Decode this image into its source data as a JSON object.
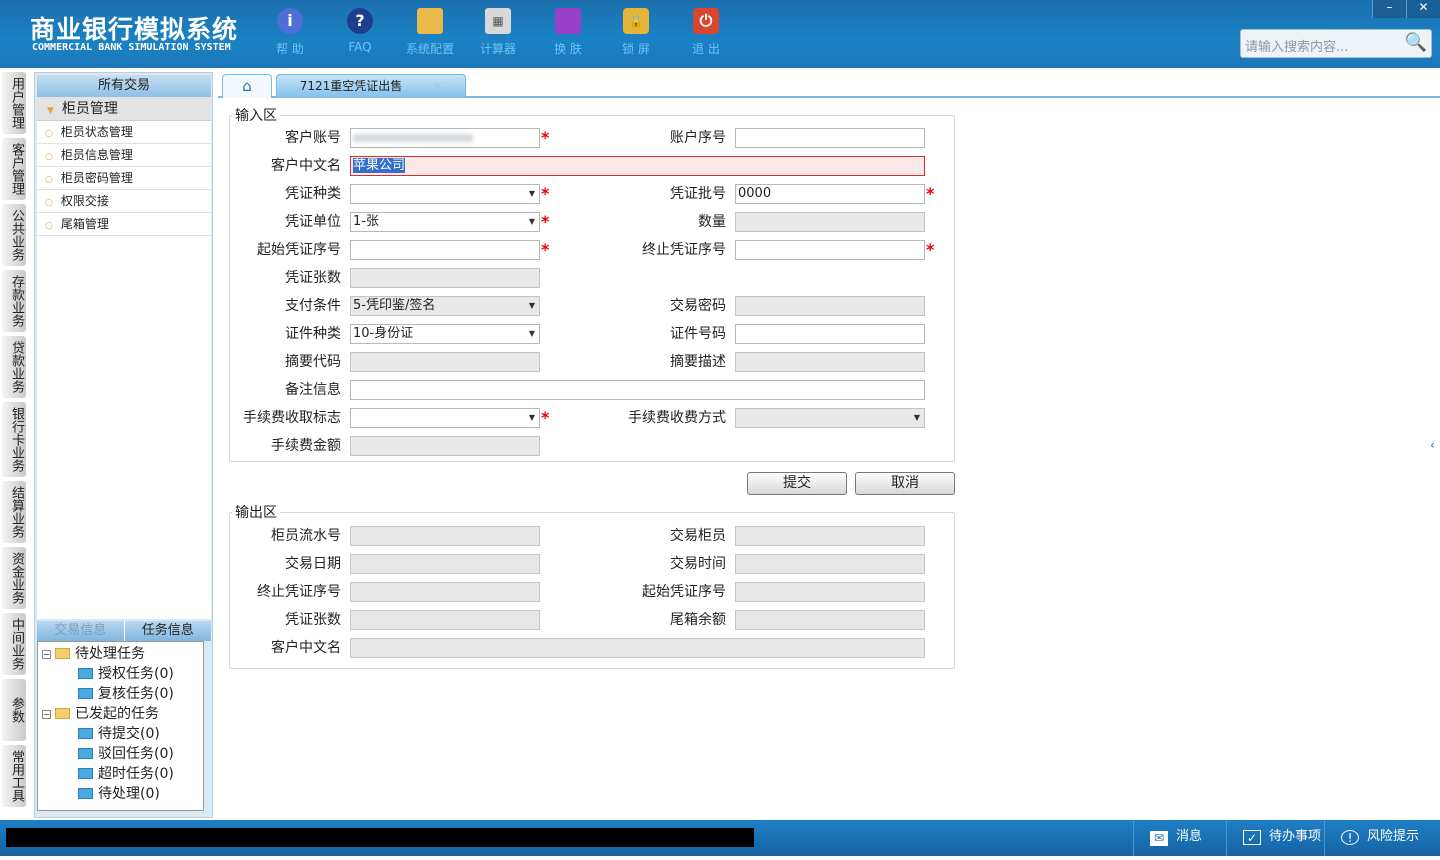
{
  "header": {
    "title_cn": "商业银行模拟系统",
    "title_en": "COMMERCIAL BANK SIMULATION SYSTEM",
    "tools": [
      {
        "label": "帮 助",
        "icon": "info-icon"
      },
      {
        "label": "FAQ",
        "icon": "help-icon"
      },
      {
        "label": "系统配置",
        "icon": "toolbox-icon"
      },
      {
        "label": "计算器",
        "icon": "calculator-icon"
      },
      {
        "label": "换 肤",
        "icon": "shirt-icon"
      },
      {
        "label": "锁 屏",
        "icon": "lock-icon"
      },
      {
        "label": "退 出",
        "icon": "power-icon"
      }
    ],
    "minimize": "–",
    "close": "✕",
    "search_placeholder": "请输入搜索内容..."
  },
  "vtabs": [
    "用户管理",
    "客户管理",
    "公共业务",
    "存款业务",
    "贷款业务",
    "银行卡业务",
    "结算业务",
    "资金业务",
    "中间业务",
    "参数",
    "常用工具"
  ],
  "sidebar": {
    "title": "所有交易",
    "group": "柜员管理",
    "items": [
      "柜员状态管理",
      "柜员信息管理",
      "柜员密码管理",
      "权限交接",
      "尾箱管理"
    ],
    "tabs": [
      "交易信息",
      "任务信息"
    ],
    "tree": [
      {
        "label": "待处理任务",
        "children": [
          "授权任务(0)",
          "复核任务(0)"
        ]
      },
      {
        "label": "已发起的任务",
        "children": [
          "待提交(0)",
          "驳回任务(0)",
          "超时任务(0)",
          "待处理(0)"
        ]
      }
    ]
  },
  "tabs": {
    "active": "7121重空凭证出售",
    "close": "×"
  },
  "input": {
    "legend": "输入区",
    "customer_account_label": "客户账号",
    "account_seq_label": "账户序号",
    "customer_name_label": "客户中文名",
    "customer_name_value": "苹果公司",
    "voucher_type_label": "凭证种类",
    "voucher_batch_label": "凭证批号",
    "voucher_batch_value": "0000",
    "voucher_unit_label": "凭证单位",
    "voucher_unit_value": "1-张",
    "quantity_label": "数量",
    "start_seq_label": "起始凭证序号",
    "end_seq_label": "终止凭证序号",
    "voucher_count_label": "凭证张数",
    "pay_cond_label": "支付条件",
    "pay_cond_value": "5-凭印鉴/签名",
    "trade_pwd_label": "交易密码",
    "id_type_label": "证件种类",
    "id_type_value": "10-身份证",
    "id_no_label": "证件号码",
    "summary_code_label": "摘要代码",
    "summary_desc_label": "摘要描述",
    "remark_label": "备注信息",
    "fee_flag_label": "手续费收取标志",
    "fee_method_label": "手续费收费方式",
    "fee_amount_label": "手续费金额"
  },
  "buttons": {
    "submit": "提交",
    "cancel": "取消"
  },
  "output": {
    "legend": "输出区",
    "teller_serial": "柜员流水号",
    "trade_teller": "交易柜员",
    "trade_date": "交易日期",
    "trade_time": "交易时间",
    "end_seq": "终止凭证序号",
    "start_seq": "起始凭证序号",
    "count": "凭证张数",
    "box_balance": "尾箱余额",
    "customer_name": "客户中文名"
  },
  "status": {
    "message": "消息",
    "todo": "待办事项",
    "risk": "风险提示"
  },
  "colors": {
    "header": "#1a82c4",
    "required": "#ee0000",
    "accent": "#7ab8e5"
  }
}
